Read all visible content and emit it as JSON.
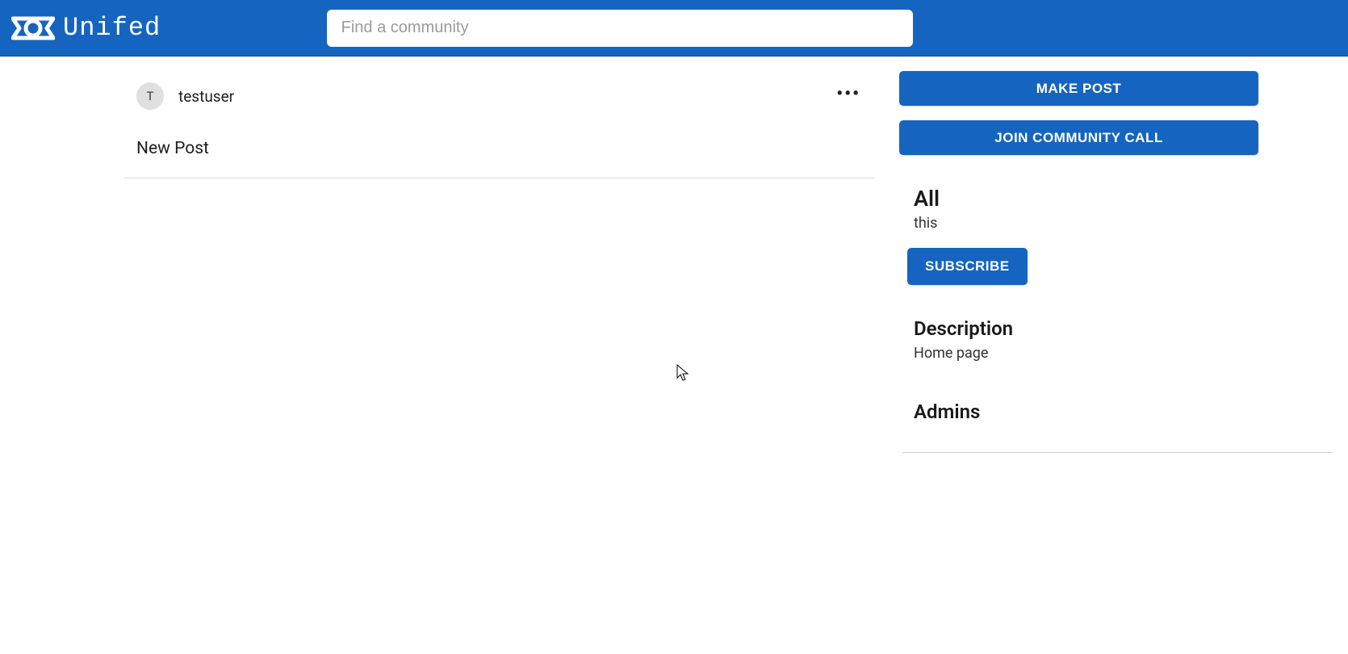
{
  "header": {
    "brand": "Unifed",
    "search_placeholder": "Find a community"
  },
  "post": {
    "avatar_initial": "T",
    "username": "testuser",
    "title": "New Post"
  },
  "sidebar": {
    "make_post_label": "MAKE POST",
    "join_call_label": "JOIN COMMUNITY CALL",
    "community": {
      "name": "All",
      "tagline": "this",
      "subscribe_label": "SUBSCRIBE"
    },
    "description": {
      "heading": "Description",
      "text": "Home page"
    },
    "admins": {
      "heading": "Admins"
    }
  }
}
